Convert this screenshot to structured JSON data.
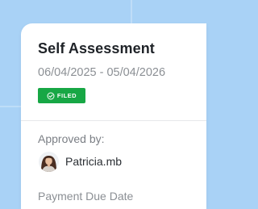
{
  "card": {
    "title": "Self Assessment",
    "period": "06/04/2025 - 05/04/2026",
    "status": {
      "label": "FILED",
      "icon": "check-circle-icon",
      "color": "#17a745"
    }
  },
  "approval": {
    "label": "Approved by:",
    "approver_name": "Patricia.mb",
    "avatar_icon": "avatar"
  },
  "next_field": {
    "label": "Payment Due Date"
  },
  "colors": {
    "background": "#a9d2f6",
    "card": "#ffffff",
    "accent_green": "#17a745"
  }
}
